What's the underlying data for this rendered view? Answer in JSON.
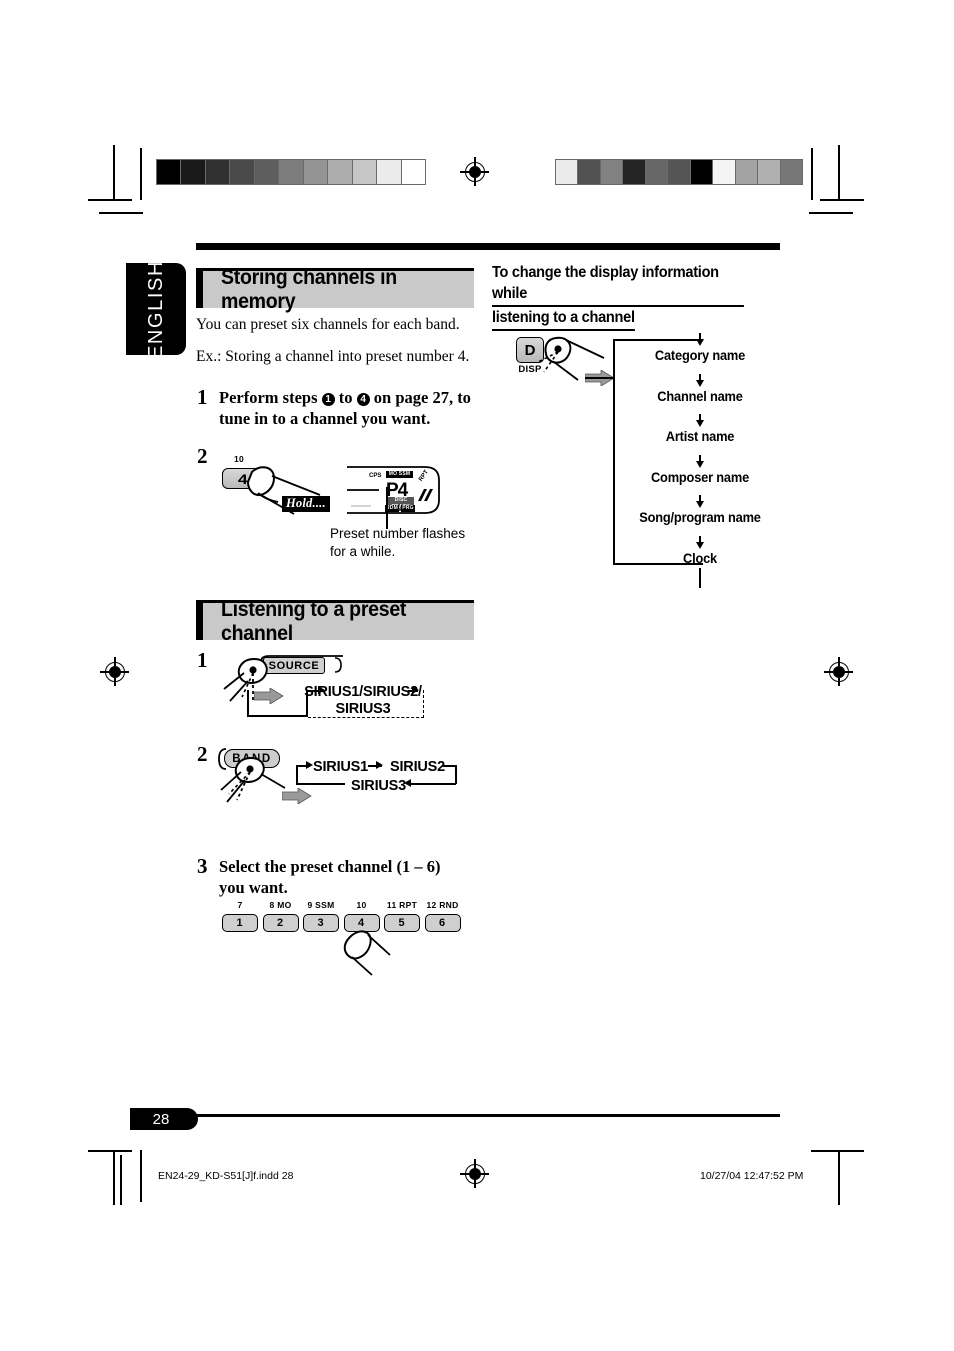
{
  "document": {
    "language_tab": "ENGLISH",
    "page_number": "28",
    "footer_left": "EN24-29_KD-S51[J]f.indd   28",
    "footer_right": "10/27/04   12:47:52 PM"
  },
  "left_column": {
    "section1": {
      "heading": "Storing channels in memory",
      "intro": "You can preset six channels for each band.",
      "example": "Ex.: Storing a channel into preset number 4.",
      "steps": [
        {
          "number": "1",
          "line1_a": "Perform steps",
          "line1_circ1": "1",
          "line1_b": "to",
          "line1_circ2": "4",
          "line1_c": "on page 27, to",
          "line2": "tune in to a channel you want."
        },
        {
          "number": "2",
          "button_top_label": "10",
          "button_face": "4",
          "hold_tag": "Hold....",
          "caption_line1": "Preset number flashes",
          "caption_line2": "for a while."
        }
      ],
      "lcd": {
        "main_value": "P4",
        "indicator_top_left": "CPS",
        "indicator_top_mid": "MO SSM",
        "indicator_top_right": "RPT",
        "indicator_bottom_mid": "DISC TRACK",
        "indicator_bottom_left": "RDM",
        "indicator_bottom_right": "PRG"
      }
    },
    "section2": {
      "heading": "Listening to a preset channel",
      "steps": [
        {
          "number": "1",
          "button_label": "SOURCE",
          "flow_line1": "SIRIUS1/SIRIUS2/",
          "flow_line2": "SIRIUS3"
        },
        {
          "number": "2",
          "button_label": "BAND",
          "band1": "SIRIUS1",
          "band2": "SIRIUS2",
          "band3": "SIRIUS3"
        },
        {
          "number": "3",
          "text_line1": "Select the preset channel (1 – 6) you",
          "text_line2": "want.",
          "preset_buttons": [
            {
              "top_label": "7",
              "face": "1"
            },
            {
              "top_label": "8 MO",
              "face": "2"
            },
            {
              "top_label": "9 SSM",
              "face": "3"
            },
            {
              "top_label": "10",
              "face": "4"
            },
            {
              "top_label": "11 RPT",
              "face": "5"
            },
            {
              "top_label": "12 RND",
              "face": "6"
            }
          ]
        }
      ]
    }
  },
  "right_column": {
    "sub_heading_line1": "To change the display information while",
    "sub_heading_line2": "listening to a channel",
    "disp_button": {
      "face": "D",
      "sub_label": "DISP"
    },
    "flow_items": [
      "Category name",
      "Channel name",
      "Artist name",
      "Composer name",
      "Song/program name",
      "Clock"
    ]
  },
  "calibration": {
    "left_bar": [
      "#000000",
      "#1a1a1a",
      "#303030",
      "#4a4a4a",
      "#5e5e5e",
      "#7d7d7d",
      "#949494",
      "#adadad",
      "#c6c6c6",
      "#ebebeb",
      "#ffffff"
    ],
    "right_bar": [
      "#ebebeb",
      "#515151",
      "#818181",
      "#242424",
      "#676767",
      "#555555",
      "#000000",
      "#f4f4f4",
      "#a3a3a3",
      "#b0b0b0",
      "#777777"
    ]
  }
}
